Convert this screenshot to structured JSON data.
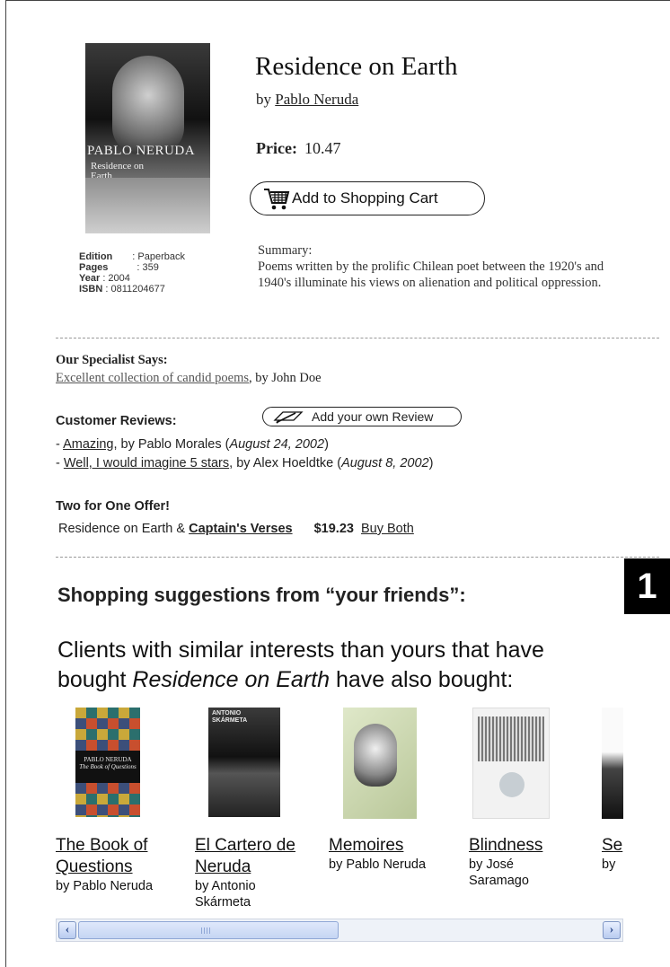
{
  "book": {
    "title": "Residence on Earth",
    "by_prefix": "by",
    "author": "Pablo Neruda",
    "price_label": "Price:",
    "price": "10.47",
    "cover_title": "PABLO NERUDA",
    "cover_subtitle": "Residence on Earth"
  },
  "details": {
    "edition_label": "Edition",
    "edition": ": Paperback",
    "pages_label": "Pages",
    "pages": ": 359",
    "year_label": "Year",
    "year": ": 2004",
    "isbn_label": "ISBN",
    "isbn": ": 0811204677"
  },
  "cart_button": {
    "label": "Add to Shopping Cart",
    "icon": "shopping-cart-icon"
  },
  "summary": {
    "heading": "Summary:",
    "text": "Poems written by the prolific Chilean poet between the 1920's and 1940's illuminate his views on alienation and political oppression."
  },
  "specialist": {
    "heading": "Our Specialist Says:",
    "review_link": "Excellent collection of candid poems",
    "reviewer": ", by John Doe"
  },
  "reviews": {
    "heading": "Customer Reviews:",
    "add_button": "Add your own Review",
    "add_icon": "pen-paper-icon",
    "items": [
      {
        "prefix": "- ",
        "link": "Amazing",
        "by": ", by Pablo Morales (",
        "date": "August 24, 2002",
        "suffix": ")"
      },
      {
        "prefix": "- ",
        "link": "Well, I would imagine 5 stars",
        "by": ", by Alex Hoeldtke (",
        "date": "August 8, 2002",
        "suffix": ")"
      }
    ]
  },
  "offer": {
    "heading": "Two for One Offer!",
    "text": "Residence on Earth & ",
    "link": "Captain's Verses",
    "price": "$19.23",
    "buy": "Buy Both"
  },
  "badge": "1",
  "suggestions": {
    "heading": "Shopping suggestions from “your friends”:",
    "text_before": "Clients with similar interests than yours that have bought ",
    "text_italic": "Residence on Earth",
    "text_after": " have also bought:",
    "items": [
      {
        "title": "The Book of Questions",
        "author": "by Pablo Neruda"
      },
      {
        "title": "El Cartero de Neruda",
        "author": "by Antonio Skármeta"
      },
      {
        "title": "Memoires",
        "author": "by Pablo Neruda"
      },
      {
        "title": "Blindness",
        "author": "by José Saramago"
      },
      {
        "title": "Se",
        "author": "by"
      }
    ]
  },
  "colors": {
    "scroll_track": "#eef2f8",
    "scroll_button": "#b8cbef",
    "badge_bg": "#000000"
  }
}
